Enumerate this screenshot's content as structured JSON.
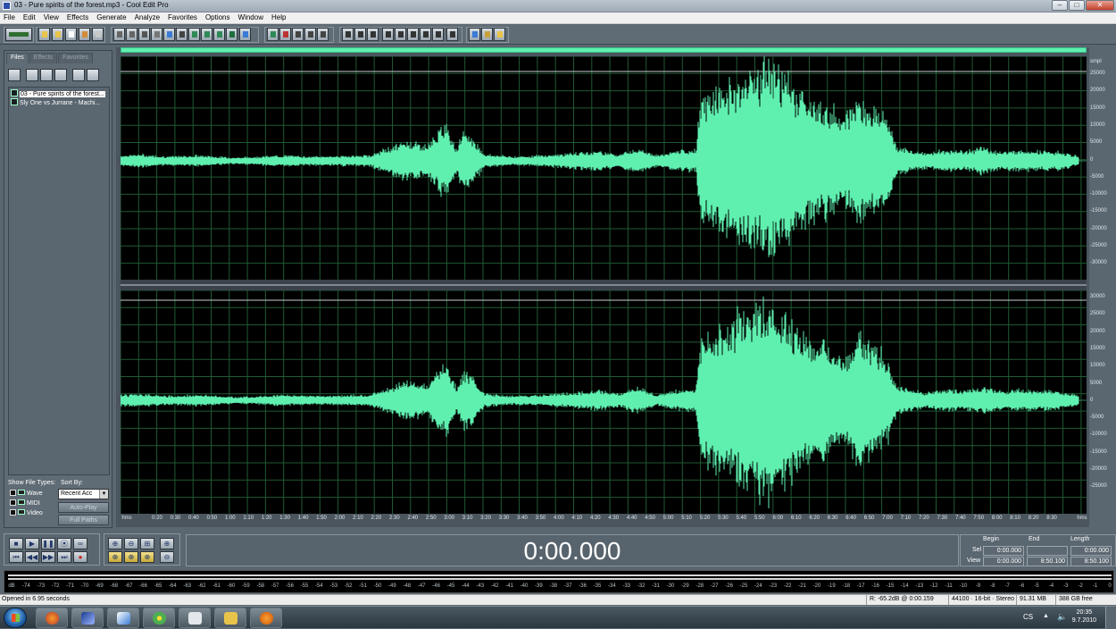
{
  "window": {
    "title": "03 - Pure spirits of the forest.mp3 - Cool Edit Pro"
  },
  "menu": [
    "File",
    "Edit",
    "View",
    "Effects",
    "Generate",
    "Analyze",
    "Favorites",
    "Options",
    "Window",
    "Help"
  ],
  "left_panel": {
    "tabs": [
      "Files",
      "Effects",
      "Favorites"
    ],
    "files": [
      "03 - Pure spirits of the forest...",
      "Sly One vs Jurrane - Machi..."
    ],
    "show_file_types_label": "Show File Types:",
    "sort_by_label": "Sort By:",
    "file_types": [
      "Wave",
      "MIDI",
      "Video"
    ],
    "sort_value": "Recent Acc",
    "auto_play": "Auto-Play",
    "full_paths": "Full Paths"
  },
  "wave": {
    "color": "#5ff0b0",
    "bg": "#000000",
    "grid": "#1f5a33",
    "amp_unit": "smpl",
    "time_unit": "hms",
    "amp_ticks_top": [
      "25000",
      "20000",
      "15000",
      "10000",
      "5000",
      "0",
      "-5000",
      "-10000",
      "-15000",
      "-20000",
      "-25000",
      "-30000"
    ],
    "amp_ticks_bottom": [
      "30000",
      "25000",
      "20000",
      "15000",
      "10000",
      "5000",
      "0",
      "-5000",
      "-10000",
      "-15000",
      "-20000",
      "-25000"
    ],
    "time_ticks": [
      "0:20",
      "0:30",
      "0:40",
      "0:50",
      "1:00",
      "1:10",
      "1:20",
      "1:30",
      "1:40",
      "1:50",
      "2:00",
      "2:10",
      "2:20",
      "2:30",
      "2:40",
      "2:50",
      "3:00",
      "3:10",
      "3:20",
      "3:30",
      "3:40",
      "3:50",
      "4:00",
      "4:10",
      "4:20",
      "4:30",
      "4:40",
      "4:50",
      "5:00",
      "5:10",
      "5:20",
      "5:30",
      "5:40",
      "5:50",
      "6:00",
      "6:10",
      "6:20",
      "6:30",
      "6:40",
      "6:50",
      "7:00",
      "7:10",
      "7:20",
      "7:30",
      "7:40",
      "7:50",
      "8:00",
      "8:10",
      "8:20",
      "8:30"
    ]
  },
  "time_display": "0:00.000",
  "selection": {
    "headers": [
      "Begin",
      "End",
      "Length"
    ],
    "sel_label": "Sel",
    "view_label": "View",
    "sel": [
      "0:00.000",
      "",
      "0:00.000"
    ],
    "view": [
      "0:00.000",
      "8:50.100",
      "8:50.100"
    ]
  },
  "level_meter": {
    "db_labels": [
      "dB",
      "-74",
      "-73",
      "-72",
      "-71",
      "-70",
      "-69",
      "-68",
      "-67",
      "-66",
      "-65",
      "-64",
      "-63",
      "-62",
      "-61",
      "-60",
      "-59",
      "-58",
      "-57",
      "-56",
      "-55",
      "-54",
      "-53",
      "-52",
      "-51",
      "-50",
      "-49",
      "-48",
      "-47",
      "-46",
      "-45",
      "-44",
      "-43",
      "-42",
      "-41",
      "-40",
      "-39",
      "-38",
      "-37",
      "-36",
      "-35",
      "-34",
      "-33",
      "-32",
      "-31",
      "-30",
      "-29",
      "-28",
      "-27",
      "-26",
      "-25",
      "-24",
      "-23",
      "-22",
      "-21",
      "-20",
      "-19",
      "-18",
      "-17",
      "-16",
      "-15",
      "-14",
      "-13",
      "-12",
      "-11",
      "-10",
      "-9",
      "-8",
      "-7",
      "-6",
      "-5",
      "-4",
      "-3",
      "-2",
      "-1",
      "0"
    ]
  },
  "status": {
    "message": "Opened in 6.95 seconds",
    "cursor": "R: -65.2dB @   0:00.159",
    "format": "44100 · 16-bit · Stereo",
    "size": "91.31 MB",
    "free": "388 GB free"
  },
  "taskbar": {
    "lang": "CS",
    "time": "20:35",
    "date": "9.7.2010"
  }
}
